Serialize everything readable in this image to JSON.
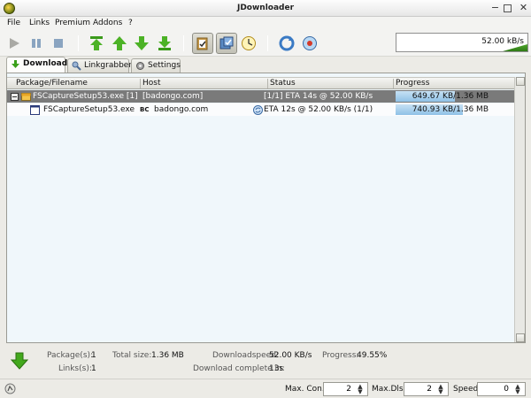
{
  "window": {
    "title": "JDownloader"
  },
  "menu": {
    "items": [
      "File",
      "Links",
      "Premium",
      "Addons",
      "?"
    ]
  },
  "toolbar": {
    "speed_value": "52.00 kB/s"
  },
  "tabs": [
    {
      "label": "Download",
      "icon": "green-down-arrow-icon"
    },
    {
      "label": "Linkgrabber",
      "icon": "linkgrabber-icon"
    },
    {
      "label": "Settings",
      "icon": "gear-icon"
    }
  ],
  "table": {
    "columns": [
      "Package/Filename",
      "Host",
      "Status",
      "Progress"
    ],
    "package": {
      "name": "FSCaptureSetup53.exe [1]",
      "host": "[badongo.com]",
      "status": "[1/1] ETA 14s @ 52.00 KB/s",
      "progress_text": "649.67 KB/1.36 MB",
      "progress_fraction": 0.47
    },
    "file": {
      "name": "FSCaptureSetup53.exe",
      "host_badge": "BC",
      "host": "badongo.com",
      "status": "ETA 12s @ 52.00 KB/s (1/1)",
      "progress_text": "740.93 KB/1.36 MB",
      "progress_fraction": 0.53
    }
  },
  "stats": {
    "packages_label": "Package(s):",
    "packages_value": "1",
    "links_label": "Links(s):",
    "links_value": "1",
    "totalsize_label": "Total size:",
    "totalsize_value": "1.36 MB",
    "speed_label": "Downloadspeed:",
    "speed_value": "52.00 KB/s",
    "progress_label": "Progress:",
    "progress_value": "49.55%",
    "complete_label": "Download complete in:",
    "complete_value": "13s"
  },
  "statusbar": {
    "maxcon_label": "Max. Con.",
    "maxcon_value": "2",
    "maxdls_label": "Max.Dls.",
    "maxdls_value": "2",
    "speed_label": "Speed",
    "speed_value": "0"
  }
}
